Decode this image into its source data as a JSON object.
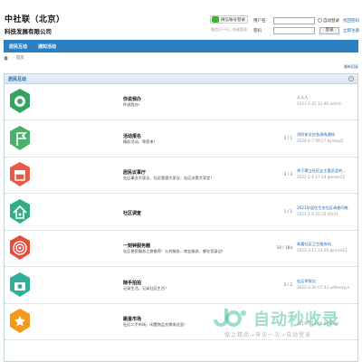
{
  "header": {
    "logo_line1": "中社联（北京）",
    "logo_line2": "科技发展有限公司",
    "wechat_label": "微信账号登录",
    "scan_hint": "微信扫一扫，快速登录",
    "username_label": "用户名",
    "password_label": "密码",
    "username_value": "",
    "password_value": "",
    "auto_login": "自动登录",
    "find_password": "找回密码",
    "login_button": "登录",
    "register": "立即注册"
  },
  "nav": {
    "items": [
      "居民互动",
      "通知活动"
    ]
  },
  "breadcrumb": {
    "current": "首页"
  },
  "newest_link": "最新回复",
  "forum": {
    "title": "居民互动",
    "rows": [
      {
        "title": "你说我办",
        "desc": "你说我办！",
        "count": "",
        "last": "人人人",
        "time": "2021-5-25 11:40 admin",
        "icon": "target-disc-icon",
        "color": "#35a35f"
      },
      {
        "title": "活动报名",
        "desc": "精彩活动，等您来！",
        "count": "1 / 1",
        "last": "消防安全应急演练通知",
        "time": "2024-4-7 09:17 Kyidaql2",
        "icon": "flag-icon",
        "color": "#4bb06a"
      },
      {
        "title": "居民议事厅",
        "desc": "社区事务大家议，社区管理大家议，社区决策大家定！",
        "count": "3 / 3",
        "last": "关于建立社区业主委员会的...",
        "time": "2022-1-6 17:24 gomse12",
        "icon": "shop-icon",
        "color": "#e85a47"
      },
      {
        "title": "社区调查",
        "desc": "",
        "count": "1 / 1",
        "last": "2021年居住生态社区调查问卷",
        "time": "2022-1-6 16:33 Sfiril1",
        "icon": "home-arrow-icon",
        "color": "#2fae86"
      },
      {
        "title": "一刻钟服务圈",
        "desc": "社区便民服务之旅推荐！公共服务，商业服务，都在您身边！",
        "count": "18 / 184",
        "last": "筑嘉社区卫生服务站",
        "time": "2022-3-11 14:26 gomse12",
        "icon": "target-rings-icon",
        "color": "#e84b3c"
      },
      {
        "title": "随手拍拍",
        "desc": "记录生活，记录社区生活！",
        "count": "2 / 2",
        "last": "社区举报点",
        "time": "2022-3-30 07:43 uddeeyjyn",
        "icon": "camera-icon",
        "color": "#2fae9c"
      },
      {
        "title": "跳蚤市场",
        "desc": "社区二手市场，闲置物品交换来这里！",
        "count": "",
        "last": "",
        "time": "2019-7-13 08:23 Bihd",
        "icon": "star-badge-icon",
        "color": "#f39a1d"
      }
    ]
  },
  "watermark": {
    "main": "自动秒收录",
    "sub": "做上精品→来访一次→自动登录"
  }
}
